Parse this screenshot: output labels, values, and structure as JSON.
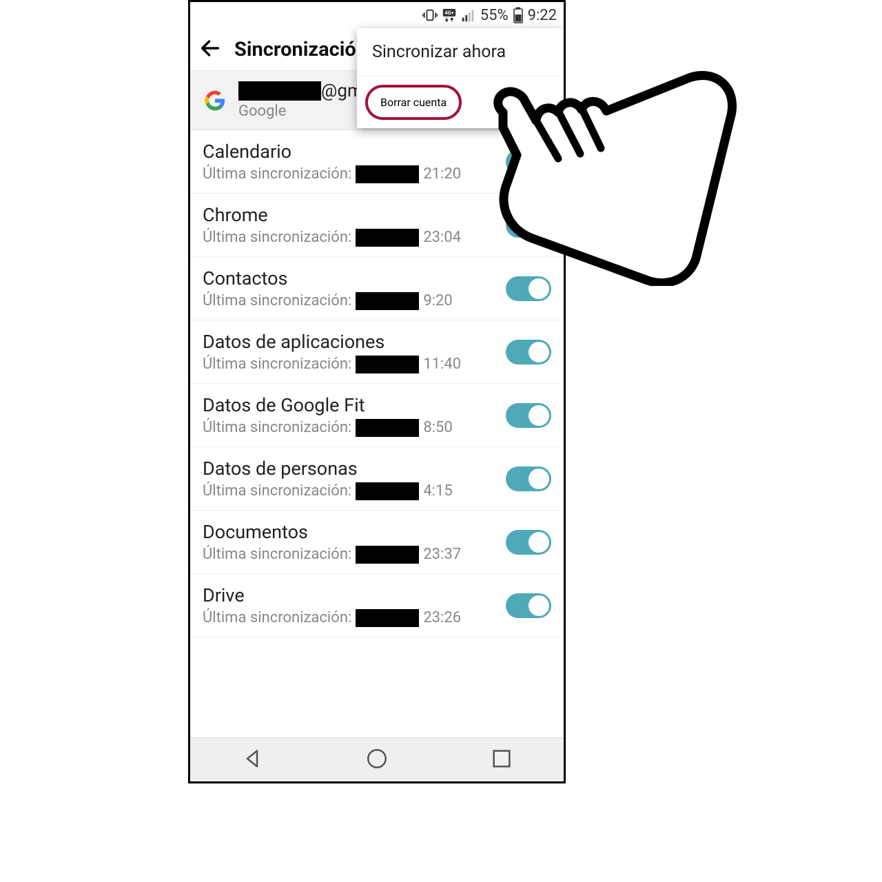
{
  "status": {
    "battery_pct": "55%",
    "time": "9:22"
  },
  "header": {
    "title": "Sincronización"
  },
  "account": {
    "email_suffix": "@gmail",
    "provider": "Google"
  },
  "popup": {
    "sync_now": "Sincronizar ahora",
    "delete_account": "Borrar cuenta"
  },
  "sync_label_prefix": "Última sincronización:",
  "items": [
    {
      "title": "Calendario",
      "time": "21:20"
    },
    {
      "title": "Chrome",
      "time": "23:04"
    },
    {
      "title": "Contactos",
      "time": "9:20"
    },
    {
      "title": "Datos de aplicaciones",
      "time": "11:40"
    },
    {
      "title": "Datos de Google Fit",
      "time": "8:50"
    },
    {
      "title": "Datos de personas",
      "time": "4:15"
    },
    {
      "title": "Documentos",
      "time": "23:37"
    },
    {
      "title": "Drive",
      "time": "23:26"
    }
  ]
}
